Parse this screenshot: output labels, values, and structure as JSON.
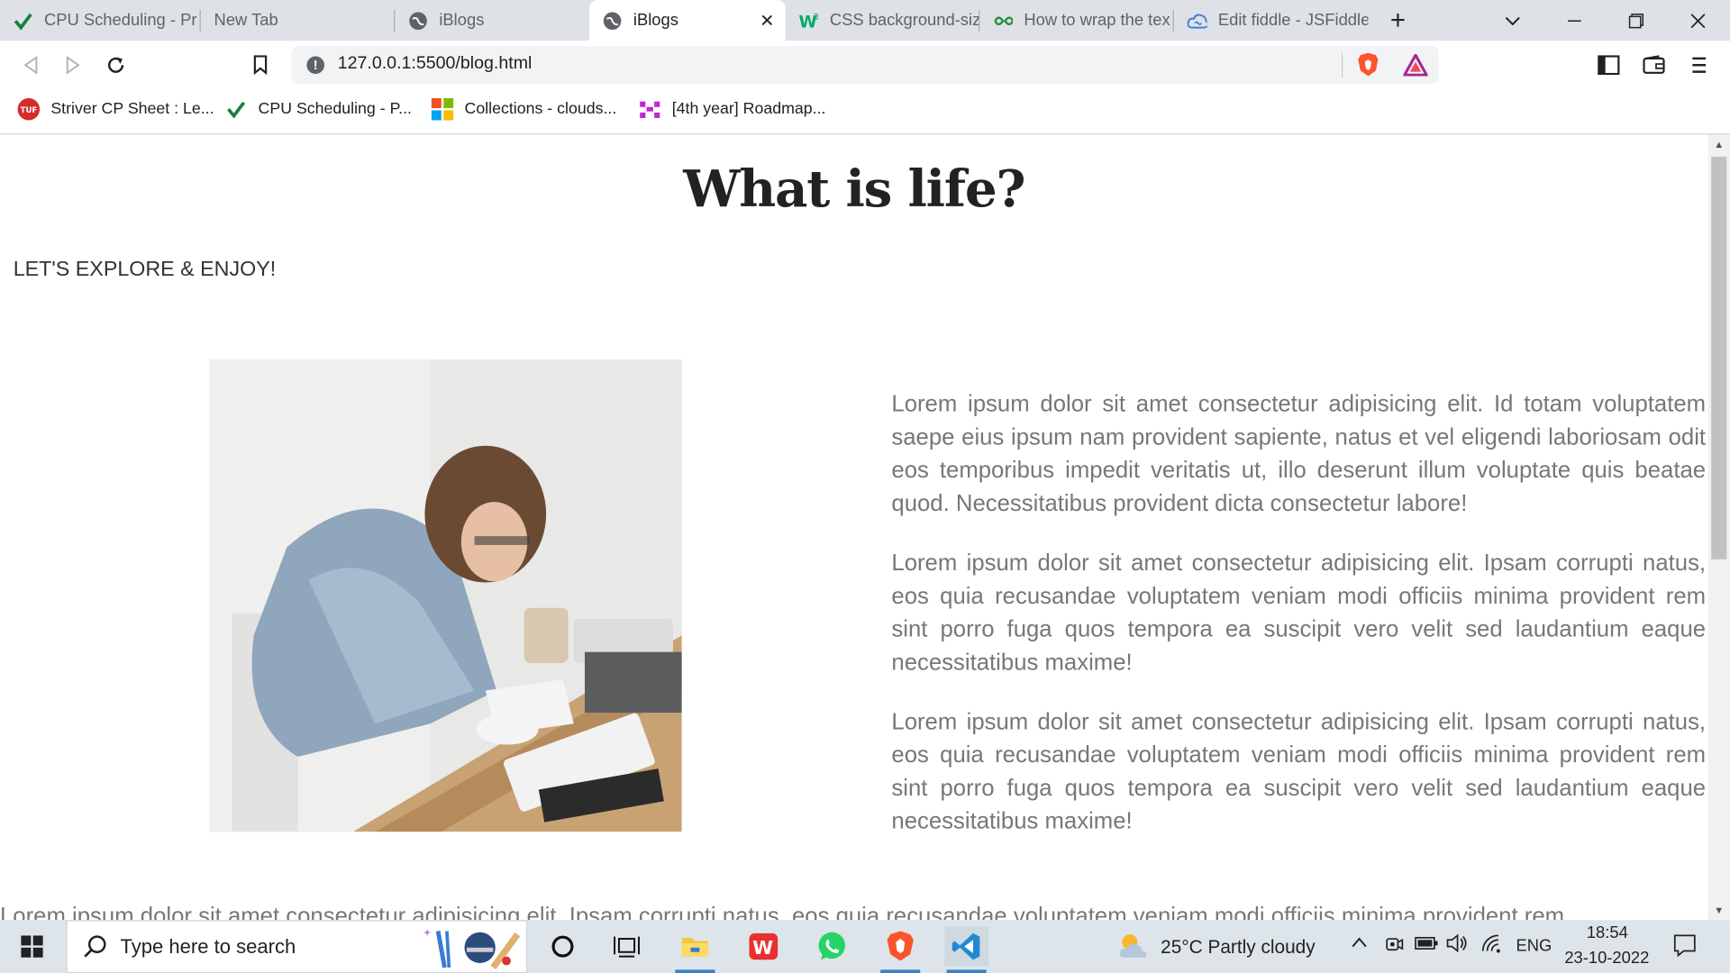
{
  "browser": {
    "tabs": [
      {
        "title": "CPU Scheduling - Pr",
        "icon": "checkmark-icon",
        "active": false
      },
      {
        "title": "New Tab",
        "icon": "",
        "active": false
      },
      {
        "title": "iBlogs",
        "icon": "globe-icon",
        "active": false
      },
      {
        "title": "iBlogs",
        "icon": "globe-icon",
        "active": true
      },
      {
        "title": "CSS background-siz",
        "icon": "w3-icon",
        "active": false
      },
      {
        "title": "How to wrap the tex",
        "icon": "gfg-icon",
        "active": false
      },
      {
        "title": "Edit fiddle - JSFiddle",
        "icon": "cloud-icon",
        "active": false
      }
    ],
    "new_tab_symbol": "+",
    "close_tab_symbol": "✕",
    "url": "127.0.0.1:5500/blog.html",
    "bookmarks": [
      {
        "label": "Striver CP Sheet : Le...",
        "icon": "tuf-icon"
      },
      {
        "label": "CPU Scheduling - P...",
        "icon": "checkmark-icon"
      },
      {
        "label": "Collections - clouds...",
        "icon": "microsoft-icon"
      },
      {
        "label": "[4th year] Roadmap...",
        "icon": "roadmap-icon"
      }
    ]
  },
  "page": {
    "title": "What is life?",
    "subtitle": "LET'S EXPLORE & ENJOY!",
    "paragraphs": [
      "Lorem ipsum dolor sit amet consectetur adipisicing elit. Id totam voluptatem saepe eius ipsum nam provident sapiente, natus et vel eligendi laboriosam odit eos temporibus impedit veritatis ut, illo deserunt illum voluptate quis beatae quod. Necessitatibus provident dicta consectetur labore!",
      "Lorem ipsum dolor sit amet consectetur adipisicing elit. Ipsam corrupti natus, eos quia recusandae voluptatem veniam modi officiis minima provident rem sint porro fuga quos tempora ea suscipit vero velit sed laudantium eaque necessitatibus maxime!",
      "Lorem ipsum dolor sit amet consectetur adipisicing elit. Ipsam corrupti natus, eos quia recusandae voluptatem veniam modi officiis minima provident rem sint porro fuga quos tempora ea suscipit vero velit sed laudantium eaque necessitatibus maxime!"
    ],
    "bottom_paragraph": "Lorem ipsum dolor sit amet consectetur adipisicing elit. Ipsam corrupti natus, eos quia recusandae voluptatem veniam modi officiis minima provident rem"
  },
  "taskbar": {
    "search_placeholder": "Type here to search",
    "weather": "25°C  Partly cloudy",
    "language": "ENG",
    "time": "18:54",
    "date": "23-10-2022"
  }
}
